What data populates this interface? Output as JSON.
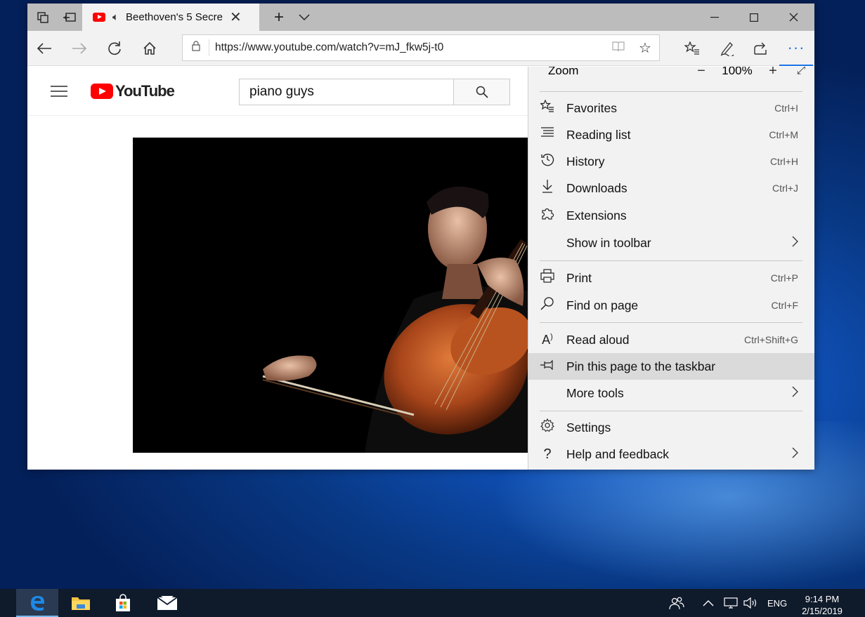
{
  "browser": {
    "tab_title": "Beethoven's 5 Secre",
    "url": "https://www.youtube.com/watch?v=mJ_fkw5j-t0"
  },
  "youtube": {
    "logo_text": "YouTube",
    "search_value": "piano guys"
  },
  "menu": {
    "zoom_label": "Zoom",
    "zoom_value": "100%",
    "items": [
      {
        "label": "Favorites",
        "shortcut": "Ctrl+I",
        "icon": "favorites-icon"
      },
      {
        "label": "Reading list",
        "shortcut": "Ctrl+M",
        "icon": "reading-list-icon"
      },
      {
        "label": "History",
        "shortcut": "Ctrl+H",
        "icon": "history-icon"
      },
      {
        "label": "Downloads",
        "shortcut": "Ctrl+J",
        "icon": "downloads-icon"
      },
      {
        "label": "Extensions",
        "shortcut": "",
        "icon": "extensions-icon"
      },
      {
        "label": "Show in toolbar",
        "shortcut": "",
        "icon": ""
      },
      {
        "label": "Print",
        "shortcut": "Ctrl+P",
        "icon": "print-icon"
      },
      {
        "label": "Find on page",
        "shortcut": "Ctrl+F",
        "icon": "find-icon"
      },
      {
        "label": "Read aloud",
        "shortcut": "Ctrl+Shift+G",
        "icon": "read-aloud-icon"
      },
      {
        "label": "Pin this page to the taskbar",
        "shortcut": "",
        "icon": "pin-icon"
      },
      {
        "label": "More tools",
        "shortcut": "",
        "icon": ""
      },
      {
        "label": "Settings",
        "shortcut": "",
        "icon": "settings-icon"
      },
      {
        "label": "Help and feedback",
        "shortcut": "",
        "icon": "help-icon"
      }
    ]
  },
  "taskbar": {
    "language": "ENG",
    "time": "9:14 PM",
    "date": "2/15/2019"
  }
}
